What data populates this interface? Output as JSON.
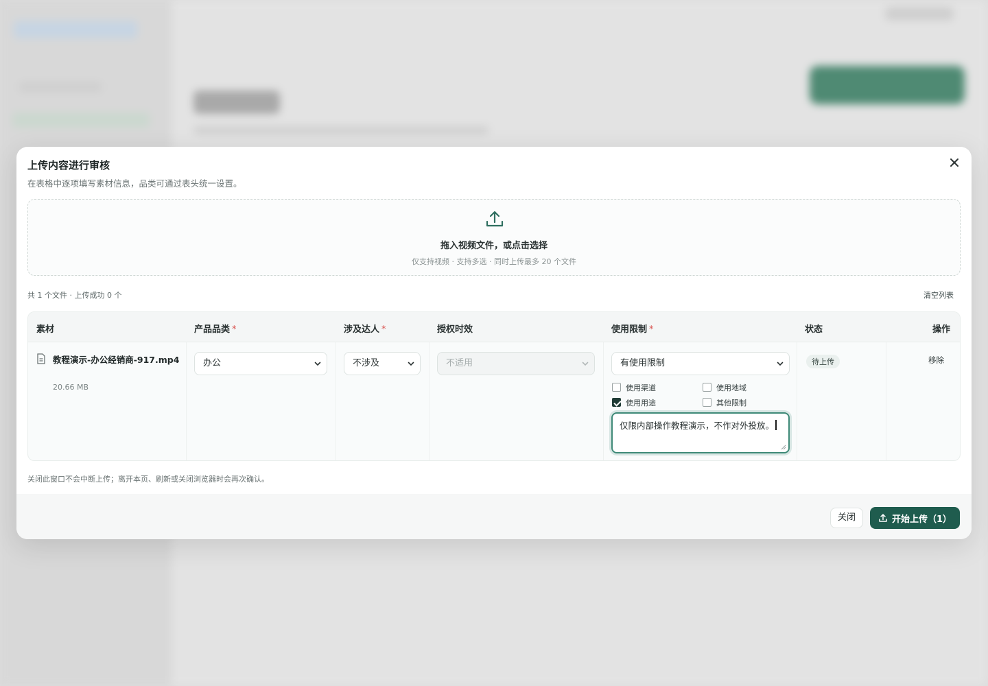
{
  "modal": {
    "title": "上传内容进行审核",
    "subtitle": "在表格中逐项填写素材信息，品类可通过表头统一设置。"
  },
  "dropzone": {
    "main": "拖入视频文件，或点击选择",
    "hint": "仅支持视频 · 支持多选 · 同时上传最多 20 个文件"
  },
  "summary": {
    "text": "共 1 个文件 · 上传成功 0 个",
    "clear_label": "清空列表"
  },
  "table": {
    "headers": {
      "material": "素材",
      "category": "产品品类",
      "influencer": "涉及达人",
      "license": "授权时效",
      "restriction": "使用限制",
      "status": "状态",
      "action": "操作"
    },
    "required_mark": "*",
    "row": {
      "file_name": "教程演示-办公经销商-917.mp4",
      "file_size": "20.66 MB",
      "category": "办公",
      "influencer": "不涉及",
      "license": "不适用",
      "restriction": "有使用限制",
      "checkboxes": [
        {
          "label": "使用渠道",
          "checked": false
        },
        {
          "label": "使用地域",
          "checked": false
        },
        {
          "label": "使用用途",
          "checked": true
        },
        {
          "label": "其他限制",
          "checked": false
        }
      ],
      "note": "仅限内部操作教程演示，不作对外投放。",
      "status": "待上传",
      "action": "移除"
    }
  },
  "footnote": "关闭此窗口不会中断上传；离开本页、刷新或关闭浏览器时会再次确认。",
  "footer": {
    "close_label": "关闭",
    "upload_label": "开始上传（1）"
  },
  "colors": {
    "primary": "#1f5c4e",
    "focus": "#3f8a78",
    "required": "#d9534f"
  },
  "icons": {
    "close": "close-icon",
    "upload": "upload-icon",
    "file": "file-icon",
    "chevron": "chevron-down-icon"
  }
}
